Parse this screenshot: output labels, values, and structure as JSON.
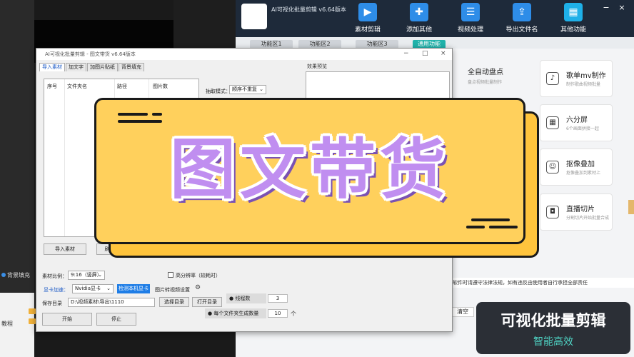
{
  "background": {
    "dock_label": "背景填充",
    "left_panel_text": "教程"
  },
  "main_window": {
    "title": "AI可视化批量剪辑 v6.64版本",
    "nav": [
      {
        "label": "素材剪辑",
        "icon": "film-icon",
        "color": "#2e8de8"
      },
      {
        "label": "添加其他",
        "icon": "add-list-icon",
        "color": "#2e8de8"
      },
      {
        "label": "视频处理",
        "icon": "sliders-icon",
        "color": "#2e8de8"
      },
      {
        "label": "导出文件名",
        "icon": "export-icon",
        "color": "#2e8de8"
      },
      {
        "label": "其他功能",
        "icon": "grid-icon",
        "color": "#1eb0e8"
      }
    ],
    "tabs": [
      "功能区1",
      "功能区2",
      "功能区3",
      "通用功能"
    ],
    "features_left": [
      {
        "title": "全自动盘点",
        "subtitle": "盘点视频批量制作"
      }
    ],
    "features_right": [
      {
        "title": "歌单mv制作",
        "subtitle": "制作歌曲视频批量",
        "icon": "music-icon"
      },
      {
        "title": "六分屏",
        "subtitle": "6个画面拼接一起",
        "icon": "grid-icon"
      },
      {
        "title": "抠像叠加",
        "subtitle": "抠像叠加到素材上",
        "icon": "portrait-icon"
      },
      {
        "title": "直播切片",
        "subtitle": "分割切片开始批量合成",
        "icon": "camera-icon"
      }
    ],
    "notice": "软件时请遵守法律法规，如有违反由使用者自行承担全部责任",
    "clear_label": "清空"
  },
  "dialog": {
    "title": "AI可视化批量剪辑 - 图文带货 v6.64版本",
    "tabs": [
      "导入素材",
      "加文字",
      "加图片贴纸",
      "背景填充"
    ],
    "table_headers": [
      "序号",
      "文件夹名",
      "路径",
      "图片数"
    ],
    "extract_label": "抽取模式：",
    "extract_value": "顺序不重复",
    "preview_label": "效果预览",
    "import_button": "导入素材",
    "refresh_button": "刷",
    "ratio_label": "素材比例：",
    "ratio_value": "9:16（竖屏）",
    "hq_label": "高分辨率（较耗时）",
    "gpu_label": "显卡加速：",
    "gpu_value": "Nvidia显卡",
    "detect_button": "检测本机显卡",
    "img2video_label": "图片转视频设置",
    "save_dir_label": "保存目录",
    "save_dir_value": "D:\\视频素材\\导出\\1110",
    "choose_dir_button": "选择目录",
    "open_dir_button": "打开目录",
    "threads_label": "线程数",
    "threads_value": "3",
    "per_folder_label": "每个文件夹生成数量",
    "per_folder_value": "10",
    "per_folder_unit": "个",
    "start_button": "开始",
    "stop_button": "停止"
  },
  "banner": {
    "text": "图文带货",
    "fill_color": "#ffd05c",
    "text_color": "#c08ef0"
  },
  "caption": {
    "line1": "可视化批量剪辑",
    "line2": "智能高效"
  }
}
